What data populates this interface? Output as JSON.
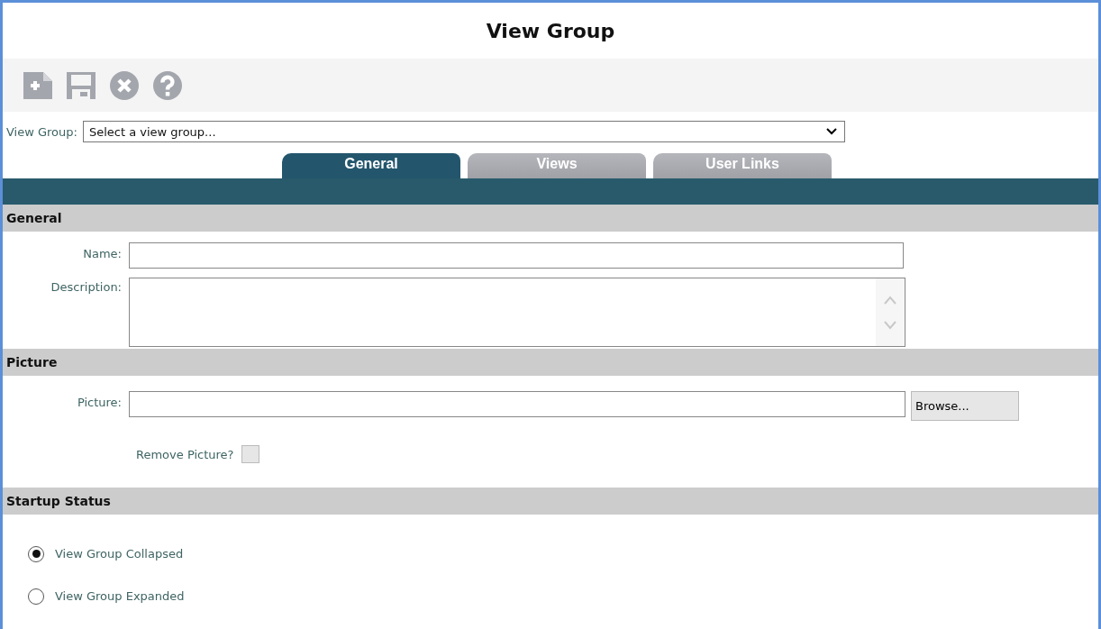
{
  "window": {
    "title": "View Group"
  },
  "toolbar": [
    {
      "kind": "new"
    },
    {
      "kind": "save"
    },
    {
      "kind": "cancel"
    },
    {
      "kind": "help"
    }
  ],
  "view_group": {
    "label": "View Group:",
    "value": "Select a view group..."
  },
  "tabs": [
    {
      "label": "General",
      "selected": true
    },
    {
      "label": "Views",
      "selected": false
    },
    {
      "label": "User Links",
      "selected": false
    }
  ],
  "sections": [
    {
      "title": "General",
      "fields": [
        {
          "kind": "text",
          "label": "Name:"
        },
        {
          "kind": "textarea",
          "label": "Description:"
        }
      ]
    },
    {
      "title": "Picture",
      "fields": [
        {
          "kind": "file",
          "label": "Picture:",
          "button": "Browse..."
        },
        {
          "kind": "checkbox",
          "label": "Remove Picture?",
          "checked": false,
          "disabled": true
        }
      ]
    },
    {
      "title": "Startup Status",
      "fields": [
        {
          "kind": "radio",
          "label": "View Group Collapsed",
          "selected": true
        },
        {
          "kind": "radio",
          "label": "View Group Expanded",
          "selected": false
        }
      ]
    }
  ]
}
